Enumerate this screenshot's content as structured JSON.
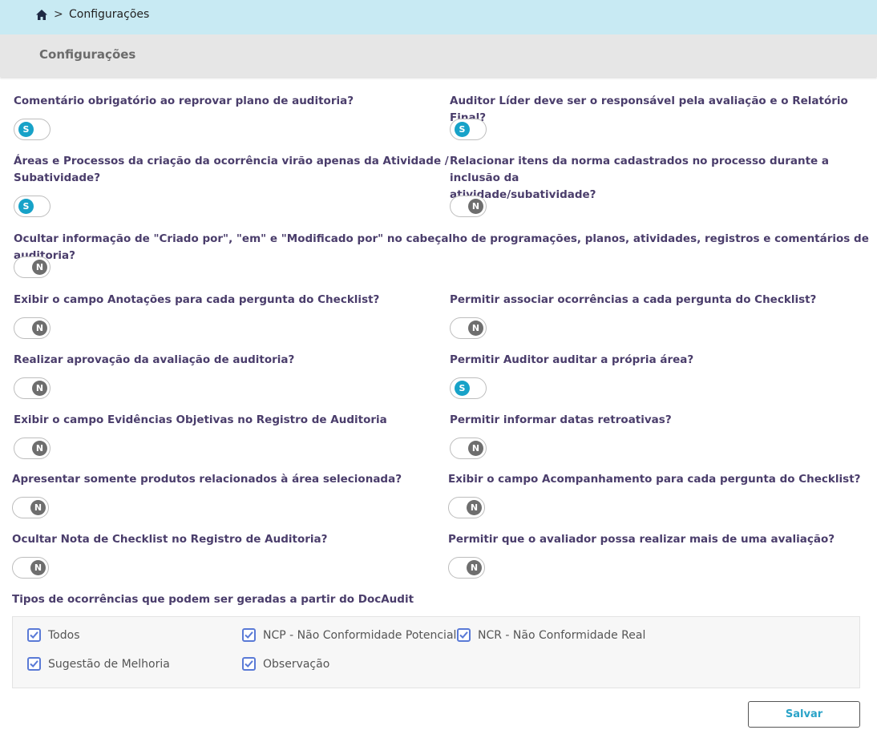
{
  "breadcrumb": {
    "home_icon": "home-icon",
    "separator": ">",
    "current": "Configurações"
  },
  "page_title": "Configurações",
  "settings": [
    {
      "question": "Comentário obrigatório ao reprovar plano de auditoria?",
      "value": "S"
    },
    {
      "question": "Auditor Líder deve ser o responsável pela avaliação e o Relatório Final?",
      "value": "S"
    },
    {
      "question": "Áreas e Processos da criação da ocorrência virão apenas da Atividade /",
      "question_line2": "Subatividade?",
      "value": "S"
    },
    {
      "question": "Relacionar itens da norma cadastrados no processo durante a inclusão da",
      "question_line2": "atividade/subatividade?",
      "value": "N"
    },
    {
      "question": "Ocultar informação de \"Criado por\", \"em\" e \"Modificado por\" no cabeçalho de programações, planos, atividades, registros e comentários de auditoria?",
      "value": "N"
    },
    {
      "question": "Exibir o campo Anotações para cada pergunta do Checklist?",
      "value": "N"
    },
    {
      "question": "Permitir associar ocorrências a cada pergunta do Checklist?",
      "value": "N"
    },
    {
      "question": "Realizar aprovação da avaliação de auditoria?",
      "value": "N"
    },
    {
      "question": "Permitir Auditor auditar a própria área?",
      "value": "S"
    },
    {
      "question": "Exibir o campo Evidências Objetivas no Registro de Auditoria",
      "value": "N"
    },
    {
      "question": "Permitir informar datas retroativas?",
      "value": "N"
    },
    {
      "question": "Apresentar somente produtos relacionados à área selecionada?",
      "value": "N"
    },
    {
      "question": "Exibir o campo Acompanhamento para cada pergunta do Checklist?",
      "value": "N"
    },
    {
      "question": "Ocultar Nota de Checklist no Registro de Auditoria?",
      "value": "N"
    },
    {
      "question": "Permitir que o avaliador possa realizar mais de uma avaliação?",
      "value": "N"
    }
  ],
  "occurrence_types": {
    "title": "Tipos de ocorrências que podem ser geradas a partir do DocAudit",
    "options": [
      {
        "label": "Todos",
        "checked": true
      },
      {
        "label": "NCP - Não Conformidade Potencial",
        "checked": true
      },
      {
        "label": "NCR - Não Conformidade Real",
        "checked": true
      },
      {
        "label": "Sugestão de Melhoria",
        "checked": true
      },
      {
        "label": "Observação",
        "checked": true
      }
    ]
  },
  "save_label": "Salvar",
  "colors": {
    "toggle_on": "#17a2c8",
    "toggle_off": "#6e6e6e",
    "question_text": "#4a3d6b",
    "topbar": "#c8eaf3",
    "checkbox": "#5a7ad6"
  }
}
